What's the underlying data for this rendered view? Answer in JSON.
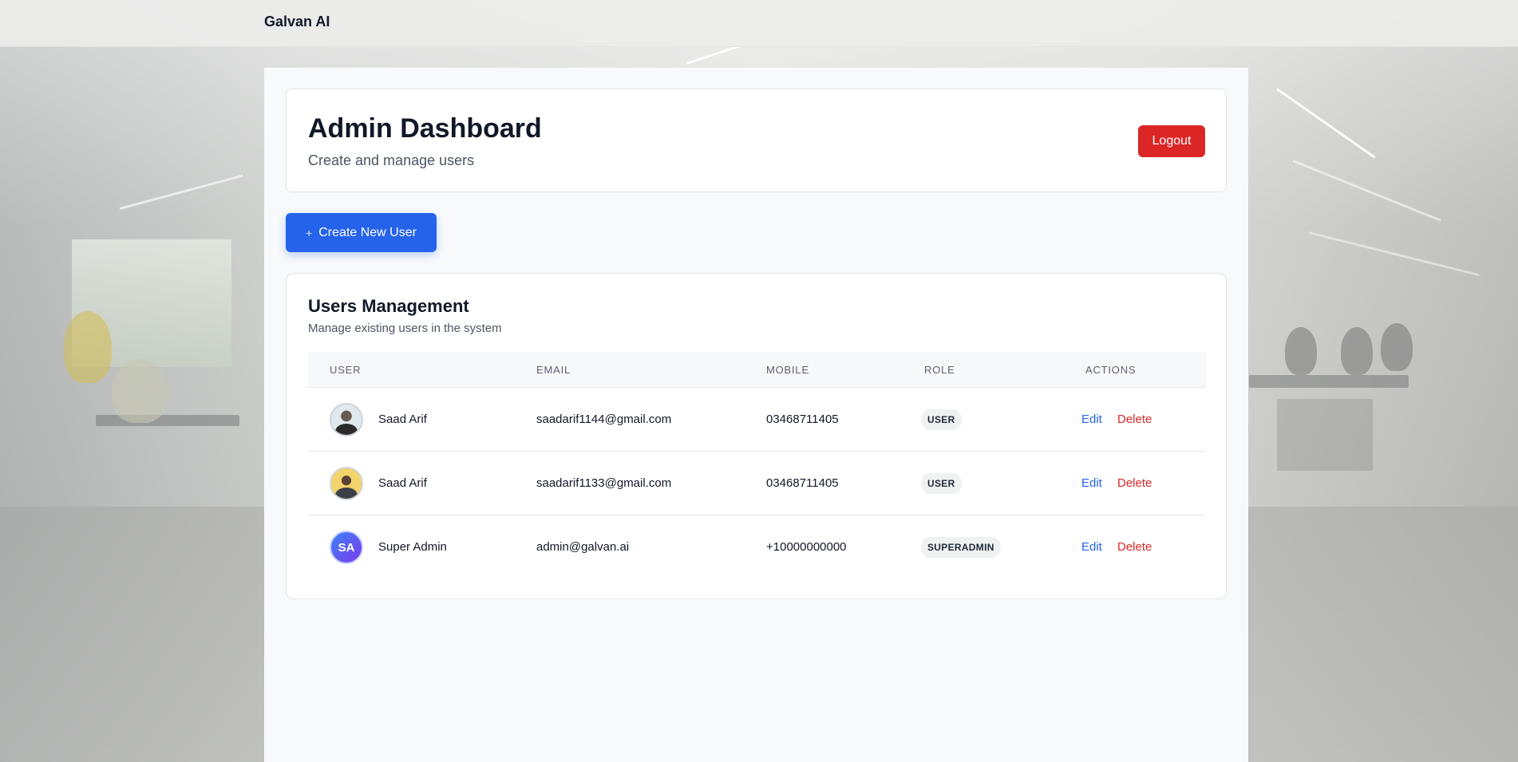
{
  "topbar": {
    "brand": "Galvan AI"
  },
  "header": {
    "title": "Admin Dashboard",
    "subtitle": "Create and manage users",
    "logout_label": "Logout"
  },
  "actions": {
    "create_user_label": "Create New User",
    "create_user_icon": "plus-icon"
  },
  "users": {
    "title": "Users Management",
    "subtitle": "Manage existing users in the system",
    "columns": [
      "USER",
      "EMAIL",
      "MOBILE",
      "ROLE",
      "ACTIONS"
    ],
    "rows": [
      {
        "avatar": "photo",
        "name": "Saad Arif",
        "email": "saadarif1144@gmail.com",
        "mobile": "03468711405",
        "role": "USER",
        "edit": "Edit",
        "delete": "Delete"
      },
      {
        "avatar": "photo",
        "name": "Saad Arif",
        "email": "saadarif1133@gmail.com",
        "mobile": "03468711405",
        "role": "USER",
        "edit": "Edit",
        "delete": "Delete"
      },
      {
        "avatar": "initials",
        "initials": "SA",
        "name": "Super Admin",
        "email": "admin@galvan.ai",
        "mobile": "+10000000000",
        "role": "SUPERADMIN",
        "edit": "Edit",
        "delete": "Delete"
      }
    ]
  },
  "colors": {
    "primary": "#2563eb",
    "danger": "#dc2626",
    "text": "#111827",
    "muted": "#4b5563"
  }
}
